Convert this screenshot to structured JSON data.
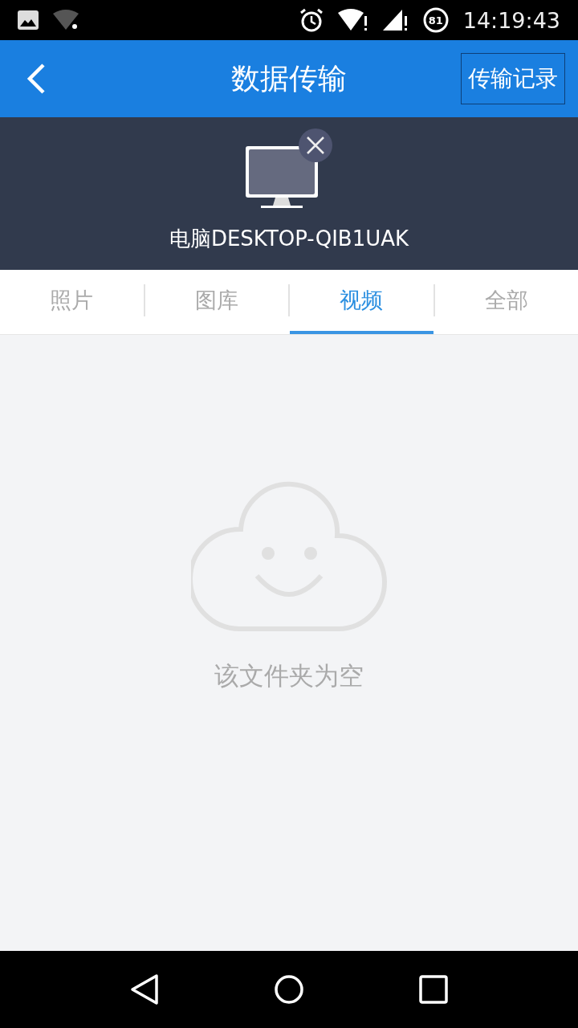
{
  "status_bar": {
    "battery": "81",
    "time": "14:19:43"
  },
  "header": {
    "title": "数据传输",
    "action": "传输记录"
  },
  "device": {
    "name": "电脑DESKTOP-QIB1UAK"
  },
  "tabs": [
    {
      "label": "照片",
      "selected": false
    },
    {
      "label": "图库",
      "selected": false
    },
    {
      "label": "视频",
      "selected": true
    },
    {
      "label": "全部",
      "selected": false
    }
  ],
  "empty_state": {
    "message": "该文件夹为空"
  }
}
